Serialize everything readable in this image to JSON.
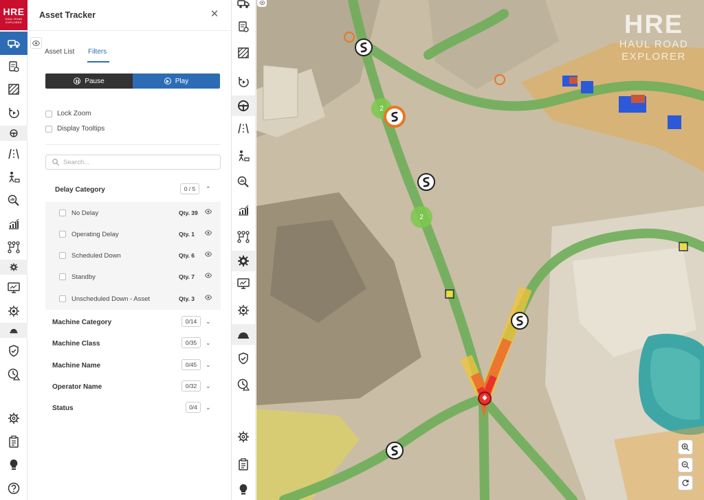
{
  "logo": {
    "main": "HRE",
    "sub": "HAUL ROAD EXPLORER"
  },
  "left_rail": {
    "icons": [
      "truck-icon",
      "document-check-icon",
      "hatch-icon",
      "replay-icon",
      "steering-group-icon",
      "road-icon",
      "workers-icon",
      "search-chart-icon",
      "bar-chart-icon",
      "hierarchy-icon",
      "gear-group-icon",
      "monitor-icon",
      "cog-icon",
      "helmet-group-icon",
      "shield-check-icon",
      "clock-warning-icon",
      "settings-icon",
      "clipboard-icon",
      "lightbulb-icon",
      "help-icon"
    ],
    "active": "truck-icon"
  },
  "panel": {
    "title": "Asset Tracker",
    "tabs": [
      {
        "label": "Asset List",
        "active": false
      },
      {
        "label": "Filters",
        "active": true
      }
    ],
    "pause_label": "Pause",
    "play_label": "Play",
    "options": [
      {
        "label": "Lock Zoom",
        "checked": false
      },
      {
        "label": "Display Tooltips",
        "checked": false
      }
    ],
    "search": {
      "placeholder": "Search...",
      "value": ""
    },
    "delay_category": {
      "label": "Delay Category",
      "count": "0 / 5",
      "expanded": true,
      "items": [
        {
          "label": "No Delay",
          "qty": "Qty. 39"
        },
        {
          "label": "Operating Delay",
          "qty": "Qty. 1"
        },
        {
          "label": "Scheduled Down",
          "qty": "Qty. 6"
        },
        {
          "label": "Standby",
          "qty": "Qty. 7"
        },
        {
          "label": "Unscheduled Down - Asset",
          "qty": "Qty. 3"
        }
      ]
    },
    "categories": [
      {
        "label": "Machine Category",
        "count": "0/14"
      },
      {
        "label": "Machine Class",
        "count": "0/35"
      },
      {
        "label": "Machine Name",
        "count": "0/45"
      },
      {
        "label": "Operator Name",
        "count": "0/32"
      },
      {
        "label": "Status",
        "count": "0/4"
      }
    ]
  },
  "map": {
    "watermark_main": "HRE",
    "watermark_sub": "HAUL ROAD EXPLORER",
    "clusters": [
      {
        "label": "2",
        "color": "#7cc94c"
      },
      {
        "label": "2",
        "color": "#7cc94c"
      }
    ],
    "zoom_controls": [
      "zoom-in-icon",
      "zoom-out-icon",
      "reset-icon"
    ],
    "colors": {
      "road": "#6fae5a",
      "heat_hot": "#e8332a",
      "heat_warm": "#f3c43a",
      "zone_orange": "#e9a640",
      "zone_yellow": "#e9dd3a"
    }
  }
}
